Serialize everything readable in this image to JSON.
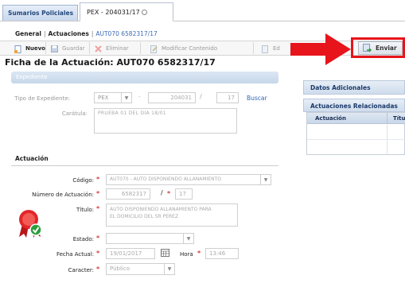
{
  "tabs": [
    {
      "label": "Sumarios Policiales"
    },
    {
      "label": "PEX - 204031/17"
    }
  ],
  "breadcrumb": {
    "general": "General",
    "actuaciones": "Actuaciones",
    "current": "AUT070 6582317/17"
  },
  "toolbar": {
    "nuevo": "Nuevo",
    "guardar": "Guardar",
    "eliminar": "Eliminar",
    "modificar": "Modificar Contenido",
    "ed": "Ed",
    "enviar": "Enviar"
  },
  "page_title": "Ficha de la Actuación: AUT070 6582317/17",
  "expediente": {
    "section_label": "Expediente",
    "tipo_label": "Tipo de Expediente:",
    "tipo_value": "PEX",
    "numero": "204031",
    "anio": "17",
    "buscar": "Buscar",
    "caratula_label": "Carátula:",
    "caratula_value": "PRUEBA 01 DEL DIA 18/01"
  },
  "actuacion": {
    "section_label": "Actuación",
    "codigo_label": "Código:",
    "codigo_value": "AUT070 - AUTO DISPONIENDO ALLANAMIENTO",
    "numero_label": "Número de Actuación:",
    "numero_value": "6582317",
    "anio_value": "17",
    "titulo_label": "Título:",
    "titulo_value_1": "AUTO DISPONIENDO ALLANAMIENTO PARA",
    "titulo_value_2": "EL DOMICILIO DEL SR PEREZ",
    "estado_label": "Estado:",
    "estado_value": "",
    "fecha_label": "Fecha Actual:",
    "fecha_value": "19/01/2017",
    "hora_label": "Hora",
    "hora_value": "13:46",
    "caracter_label": "Caracter:",
    "caracter_value": "Público"
  },
  "right": {
    "datos_adicionales": "Datos Adicionales",
    "actuaciones_relacionadas": "Actuaciones Relacionadas",
    "col_actuacion": "Actuación",
    "col_titulo": "Títul"
  },
  "colors": {
    "accent": "#3d6cb4",
    "highlight": "#e8141b",
    "required": "#d43b3b"
  }
}
